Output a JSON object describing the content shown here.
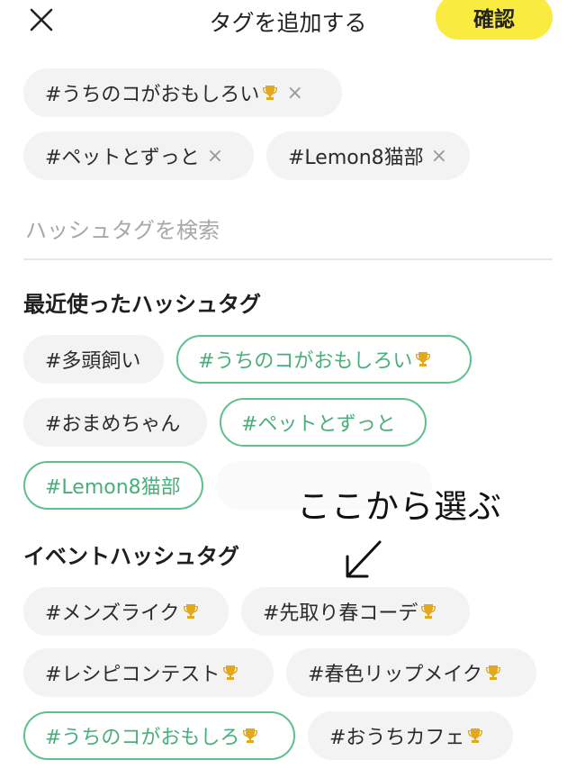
{
  "header": {
    "title": "タグを追加する",
    "confirm_label": "確認"
  },
  "selected_tags": [
    {
      "label": "#うちのコがおもしろい",
      "has_trophy": true,
      "remove": "×"
    },
    {
      "label": "#ペットとずっと",
      "has_trophy": false,
      "remove": "×"
    },
    {
      "label": "#Lemon8猫部",
      "has_trophy": false,
      "remove": "×"
    }
  ],
  "search": {
    "placeholder": "ハッシュタグを検索"
  },
  "recent": {
    "title": "最近使ったハッシュタグ",
    "tags": [
      {
        "label": "#多頭飼い",
        "selected": false
      },
      {
        "label": "#うちのコがおもしろい",
        "selected": true,
        "has_trophy": true
      },
      {
        "label": "#おまめちゃん",
        "selected": false
      },
      {
        "label": "#ペットとずっと",
        "selected": true
      },
      {
        "label": "#Lemon8猫部",
        "selected": true
      }
    ]
  },
  "annotation": {
    "text": "ここから選ぶ"
  },
  "event": {
    "title": "イベントハッシュタグ",
    "tags": [
      {
        "label": "#メンズライク",
        "selected": false,
        "has_trophy": true
      },
      {
        "label": "#先取り春コーデ",
        "selected": false,
        "has_trophy": true
      },
      {
        "label": "#レシピコンテスト",
        "selected": false,
        "has_trophy": true
      },
      {
        "label": "#春色リップメイク",
        "selected": false,
        "has_trophy": true
      },
      {
        "label": "#うちのコがおもしろ",
        "selected": true,
        "has_trophy": true
      },
      {
        "label": "#おうちカフェ",
        "selected": false,
        "has_trophy": true
      }
    ]
  },
  "colors": {
    "accent_yellow": "#f9eb3f",
    "selected_green": "#4aae7c",
    "chip_bg": "#f3f3f3"
  }
}
